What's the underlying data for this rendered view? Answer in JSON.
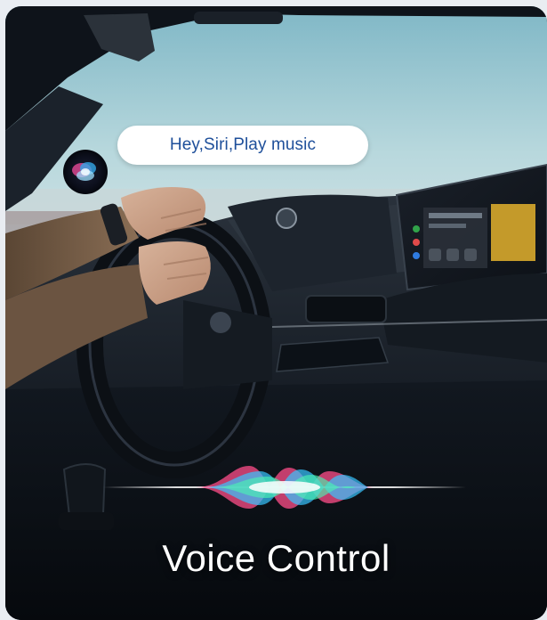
{
  "speech_bubble": {
    "text": "Hey,Siri,Play music"
  },
  "caption": {
    "title": "Voice Control"
  },
  "icons": {
    "assistant": "siri-orb-icon",
    "waveform": "voice-waveform-icon"
  },
  "colors": {
    "bubble_text": "#1e4f9a",
    "title_text": "#ffffff"
  }
}
